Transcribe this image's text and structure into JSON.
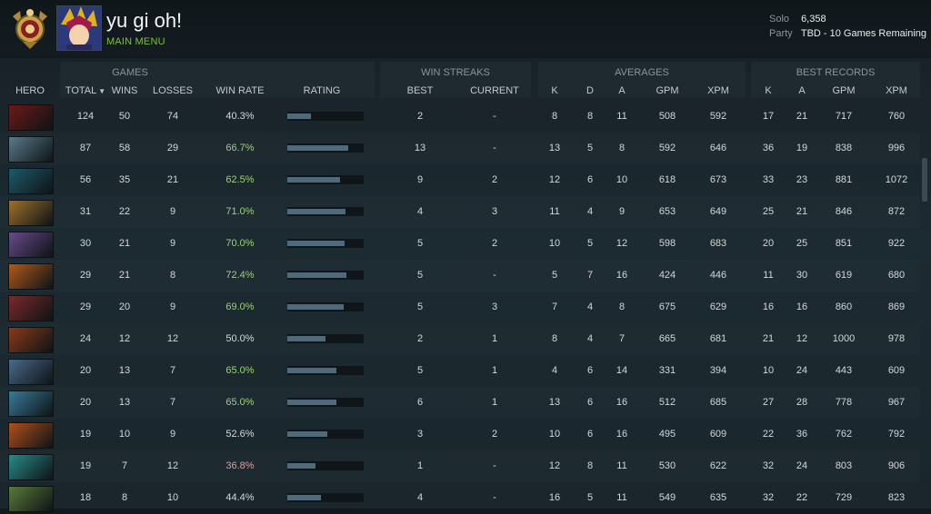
{
  "header": {
    "player_name": "yu gi oh!",
    "menu_link": "MAIN MENU",
    "solo_label": "Solo",
    "solo_value": "6,358",
    "party_label": "Party",
    "party_value": "TBD - 10 Games Remaining"
  },
  "groups": {
    "games": "GAMES",
    "win_streaks": "WIN STREAKS",
    "averages": "AVERAGES",
    "best_records": "BEST RECORDS"
  },
  "columns": {
    "hero": "HERO",
    "total": "TOTAL",
    "wins": "WINS",
    "losses": "LOSSES",
    "win_rate": "WIN RATE",
    "rating": "RATING",
    "best": "BEST",
    "current": "CURRENT",
    "avg_k": "K",
    "avg_d": "D",
    "avg_a": "A",
    "avg_gpm": "GPM",
    "avg_xpm": "XPM",
    "best_k": "K",
    "best_a": "A",
    "best_gpm": "GPM",
    "best_xpm": "XPM"
  },
  "colors": {
    "win_rate_good": "#9bd27a",
    "win_rate_bad": "#e39aa0",
    "accent_green": "#7fbf3f",
    "rating_bar": "#4f6b7b"
  },
  "icons": {
    "sort": "chevron-down-icon",
    "rank": "rank-medal-icon"
  },
  "rows": [
    {
      "hero_color": "#6b1a16",
      "total": "124",
      "wins": "50",
      "losses": "74",
      "win_rate": "40.3%",
      "rate_tone": "mid",
      "rating": 0.31,
      "best": "2",
      "current": "-",
      "k": "8",
      "d": "8",
      "a": "11",
      "gpm": "508",
      "xpm": "592",
      "bk": "17",
      "ba": "21",
      "bgpm": "717",
      "bxpm": "760"
    },
    {
      "hero_color": "#5a7a8a",
      "total": "87",
      "wins": "58",
      "losses": "29",
      "win_rate": "66.7%",
      "rate_tone": "good",
      "rating": 0.8,
      "best": "13",
      "current": "-",
      "k": "13",
      "d": "5",
      "a": "8",
      "gpm": "592",
      "xpm": "646",
      "bk": "36",
      "ba": "19",
      "bgpm": "838",
      "bxpm": "996"
    },
    {
      "hero_color": "#1f5a6a",
      "total": "56",
      "wins": "35",
      "losses": "21",
      "win_rate": "62.5%",
      "rate_tone": "good",
      "rating": 0.69,
      "best": "9",
      "current": "2",
      "k": "12",
      "d": "6",
      "a": "10",
      "gpm": "618",
      "xpm": "673",
      "bk": "33",
      "ba": "23",
      "bgpm": "881",
      "bxpm": "1072"
    },
    {
      "hero_color": "#a0702a",
      "total": "31",
      "wins": "22",
      "losses": "9",
      "win_rate": "71.0%",
      "rate_tone": "good",
      "rating": 0.76,
      "best": "4",
      "current": "3",
      "k": "11",
      "d": "4",
      "a": "9",
      "gpm": "653",
      "xpm": "649",
      "bk": "25",
      "ba": "21",
      "bgpm": "846",
      "bxpm": "872"
    },
    {
      "hero_color": "#6a4a8a",
      "total": "30",
      "wins": "21",
      "losses": "9",
      "win_rate": "70.0%",
      "rate_tone": "good",
      "rating": 0.75,
      "best": "5",
      "current": "2",
      "k": "10",
      "d": "5",
      "a": "12",
      "gpm": "598",
      "xpm": "683",
      "bk": "20",
      "ba": "25",
      "bgpm": "851",
      "bxpm": "922"
    },
    {
      "hero_color": "#b05a1a",
      "total": "29",
      "wins": "21",
      "losses": "8",
      "win_rate": "72.4%",
      "rate_tone": "good",
      "rating": 0.77,
      "best": "5",
      "current": "-",
      "k": "5",
      "d": "7",
      "a": "16",
      "gpm": "424",
      "xpm": "446",
      "bk": "11",
      "ba": "30",
      "bgpm": "619",
      "bxpm": "680"
    },
    {
      "hero_color": "#7a2a2a",
      "total": "29",
      "wins": "20",
      "losses": "9",
      "win_rate": "69.0%",
      "rate_tone": "good",
      "rating": 0.74,
      "best": "5",
      "current": "3",
      "k": "7",
      "d": "4",
      "a": "8",
      "gpm": "675",
      "xpm": "629",
      "bk": "16",
      "ba": "16",
      "bgpm": "860",
      "bxpm": "869"
    },
    {
      "hero_color": "#8a3a1a",
      "total": "24",
      "wins": "12",
      "losses": "12",
      "win_rate": "50.0%",
      "rate_tone": "mid",
      "rating": 0.5,
      "best": "2",
      "current": "1",
      "k": "8",
      "d": "4",
      "a": "7",
      "gpm": "665",
      "xpm": "681",
      "bk": "21",
      "ba": "12",
      "bgpm": "1000",
      "bxpm": "978"
    },
    {
      "hero_color": "#4a6a8a",
      "total": "20",
      "wins": "13",
      "losses": "7",
      "win_rate": "65.0%",
      "rate_tone": "good",
      "rating": 0.64,
      "best": "5",
      "current": "1",
      "k": "4",
      "d": "6",
      "a": "14",
      "gpm": "331",
      "xpm": "394",
      "bk": "10",
      "ba": "24",
      "bgpm": "443",
      "bxpm": "609"
    },
    {
      "hero_color": "#3a7a9a",
      "total": "20",
      "wins": "13",
      "losses": "7",
      "win_rate": "65.0%",
      "rate_tone": "good",
      "rating": 0.64,
      "best": "6",
      "current": "1",
      "k": "13",
      "d": "6",
      "a": "16",
      "gpm": "512",
      "xpm": "685",
      "bk": "27",
      "ba": "28",
      "bgpm": "778",
      "bxpm": "967"
    },
    {
      "hero_color": "#b0501a",
      "total": "19",
      "wins": "10",
      "losses": "9",
      "win_rate": "52.6%",
      "rate_tone": "mid",
      "rating": 0.52,
      "best": "3",
      "current": "2",
      "k": "10",
      "d": "6",
      "a": "16",
      "gpm": "495",
      "xpm": "609",
      "bk": "22",
      "ba": "36",
      "bgpm": "762",
      "bxpm": "792"
    },
    {
      "hero_color": "#2a8a8a",
      "total": "19",
      "wins": "7",
      "losses": "12",
      "win_rate": "36.8%",
      "rate_tone": "bad",
      "rating": 0.37,
      "best": "1",
      "current": "-",
      "k": "12",
      "d": "8",
      "a": "11",
      "gpm": "530",
      "xpm": "622",
      "bk": "32",
      "ba": "24",
      "bgpm": "803",
      "bxpm": "906"
    },
    {
      "hero_color": "#5a7a3a",
      "total": "18",
      "wins": "8",
      "losses": "10",
      "win_rate": "44.4%",
      "rate_tone": "mid",
      "rating": 0.44,
      "best": "4",
      "current": "-",
      "k": "16",
      "d": "5",
      "a": "11",
      "gpm": "549",
      "xpm": "635",
      "bk": "32",
      "ba": "22",
      "bgpm": "729",
      "bxpm": "823"
    }
  ]
}
